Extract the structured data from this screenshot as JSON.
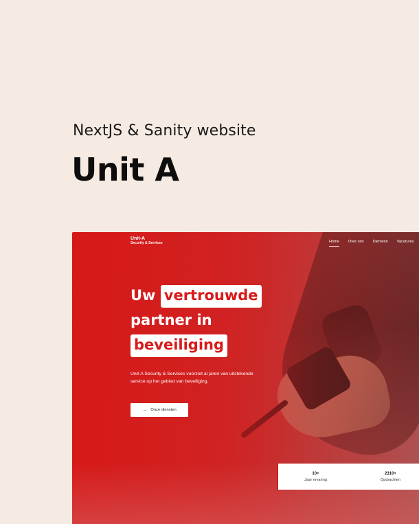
{
  "page": {
    "kicker": "NextJS & Sanity website",
    "headline": "Unit A"
  },
  "site": {
    "brand_name": "Unit-A",
    "brand_tagline": "Security & Services",
    "nav": [
      "Home",
      "Over ons",
      "Diensten",
      "Vacatures"
    ],
    "active_nav": "Home",
    "hero": {
      "title_line1_prefix": "Uw",
      "title_line1_highlight": "vertrouwde",
      "title_line2": "partner in",
      "title_line3_highlight": "beveiliging",
      "body": "Unit-A Security & Services voorziet al jaren van uitstekende service op het gebied van beveiliging.",
      "cta_label": "Onze diensten",
      "cta_icon": "arrow-right-icon"
    },
    "stats": [
      {
        "value": "10+",
        "label": "Jaar ervaring"
      },
      {
        "value": "2310+",
        "label": "Opdrachten"
      }
    ],
    "colors": {
      "accent": "#d81a1a",
      "background": "#f6ebe2"
    }
  }
}
